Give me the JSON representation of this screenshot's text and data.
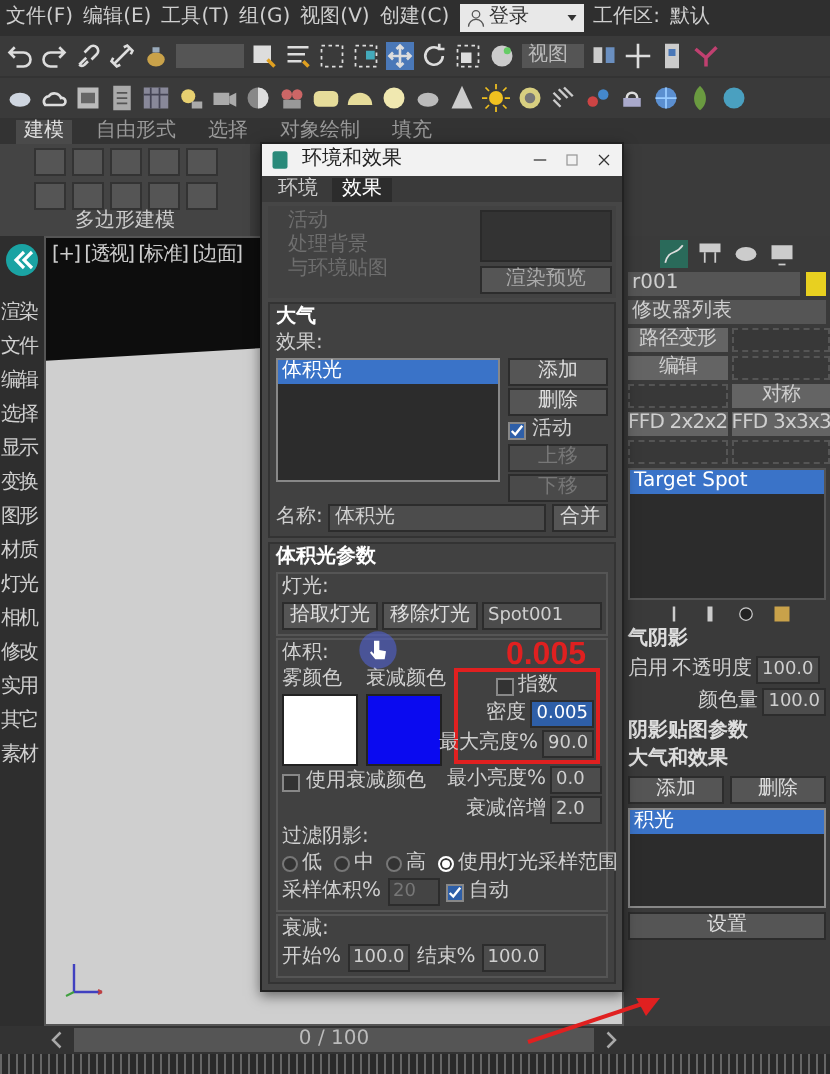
{
  "menu_bar": {
    "items": [
      "文件(F)",
      "编辑(E)",
      "工具(T)",
      "组(G)",
      "视图(V)",
      "创建(C)"
    ],
    "login": "登录",
    "workspace_label": "工作区:",
    "workspace": "默认"
  },
  "toolbar": {
    "view_dropdown": "视图"
  },
  "ribbon": {
    "tabs": [
      {
        "label": "建模",
        "selected": true
      },
      {
        "label": "自由形式",
        "selected": false
      },
      {
        "label": "选择",
        "selected": false
      },
      {
        "label": "对象绘制",
        "selected": false
      },
      {
        "label": "填充",
        "selected": false
      }
    ],
    "panel_label": "多边形建模"
  },
  "command_panel": {
    "items": [
      "渲染",
      "文件",
      "编辑",
      "选择",
      "显示",
      "变换",
      "图形",
      "材质",
      "灯光",
      "相机",
      "修改",
      "实用",
      "其它",
      "素材"
    ]
  },
  "viewport": {
    "label": "[+] [透视] [标准] [边面]"
  },
  "dialog": {
    "title": "环境和效果",
    "tabs": [
      {
        "label": "环境",
        "selected": false
      },
      {
        "label": "效果",
        "selected": true
      }
    ],
    "effects_panel": {
      "active_label": "活动",
      "process_lines": [
        "处理背景",
        "与环境贴图"
      ],
      "render_preview": "渲染预览"
    },
    "atmosphere": {
      "title": "大气",
      "effects_label": "效果:",
      "effects": [
        {
          "label": "体积光",
          "selected": true
        }
      ],
      "add": "添加",
      "delete": "删除",
      "active_label": "活动",
      "active": true,
      "move_up": "上移",
      "move_down": "下移",
      "name_label": "名称:",
      "name": "体积光",
      "merge": "合并"
    },
    "volume_light": {
      "title": "体积光参数",
      "lights_label": "灯光:",
      "pick_light": "拾取灯光",
      "remove_light": "移除灯光",
      "light": "Spot001",
      "volume_label": "体积:",
      "swatches": [
        {
          "label": "雾颜色",
          "color": "#ffffff"
        },
        {
          "label": "衰减颜色",
          "color": "#0a0af0"
        }
      ],
      "exponential_label": "指数",
      "exponential": false,
      "density_label": "密度",
      "density": "0.005",
      "max_bright_label": "最大亮度%",
      "max_bright": "90.0",
      "min_bright_label": "最小亮度%",
      "min_bright": "0.0",
      "atten_mult_label": "衰减倍增",
      "atten_mult": "2.0",
      "use_atten_label": "使用衰减颜色",
      "use_atten": false,
      "filter_label": "过滤阴影:",
      "filter_options": [
        {
          "label": "低",
          "selected": false
        },
        {
          "label": "中",
          "selected": false
        },
        {
          "label": "高",
          "selected": false
        },
        {
          "label": "使用灯光采样范围",
          "selected": true
        }
      ],
      "sample_label": "采样体积%",
      "sample": "20",
      "sample_disabled": true,
      "auto_label": "自动",
      "auto": true,
      "atten_label": "衰减:",
      "start_label": "开始%",
      "start": "100.0",
      "end_label": "结束%",
      "end": "100.0"
    }
  },
  "annotation": {
    "text": "0.005"
  },
  "right_panel": {
    "object_name": "r001",
    "modifier_list": "修改器列表",
    "modifier_buttons": [
      {
        "label": "路径变形",
        "disabled": false
      },
      {
        "disabled": true
      },
      {
        "label": "编辑",
        "disabled": false
      },
      {
        "disabled": true
      },
      {
        "disabled": true
      },
      {
        "label": "对称",
        "disabled": false
      },
      {
        "label": "FFD 2x2x2",
        "disabled": false
      },
      {
        "label": "FFD 3x3x3",
        "disabled": false
      },
      {
        "disabled": true
      },
      {
        "disabled": true
      }
    ],
    "stack": [
      {
        "label": "Target Spot",
        "selected": true
      }
    ],
    "shadow_title": "气阴影",
    "enable_label": "启用",
    "opacity_label": "不透明度",
    "opacity": "100.0",
    "color_amount_label": "颜色量",
    "color_amount": "100.0",
    "rollouts": [
      "阴影贴图参数",
      "大气和效果"
    ],
    "add": "添加",
    "delete": "删除",
    "effects": [
      {
        "label": "积光",
        "selected": true
      }
    ],
    "setup": "设置"
  },
  "timeline": {
    "frame": "0 / 100"
  }
}
